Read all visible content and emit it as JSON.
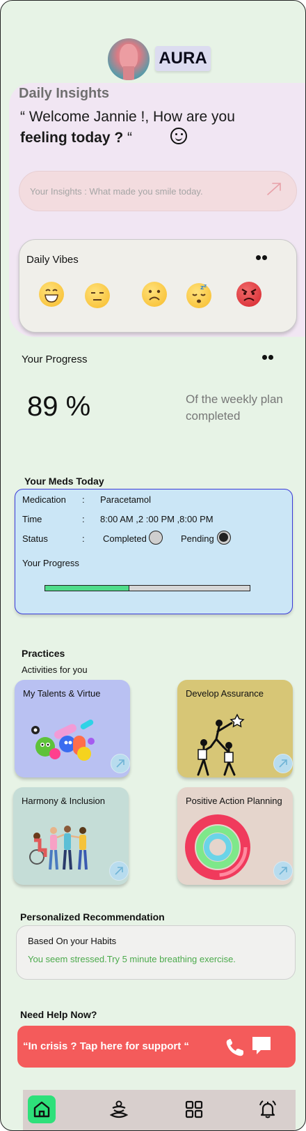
{
  "app": {
    "name": "AURA"
  },
  "insights": {
    "title": "Daily Insights",
    "welcome_prefix": "“ Welcome Jannie !, How are you ",
    "welcome_bold": "feeling today ? ",
    "welcome_suffix": "“",
    "input_placeholder": "Your Insights : What made you smile today."
  },
  "vibes": {
    "title": "Daily Vibes",
    "emojis": [
      "grinning-face",
      "expressionless-face",
      "frowning-face",
      "sleeping-face",
      "angry-face"
    ]
  },
  "progress": {
    "title": "Your Progress",
    "percent": "89 %",
    "caption": "Of the weekly plan completed"
  },
  "meds": {
    "title": "Your Meds Today",
    "medication_label": "Medication",
    "medication_value": "Paracetamol",
    "time_label": "Time",
    "time_value": "8:00 AM ,2 :00 PM ,8:00 PM",
    "status_label": "Status",
    "colon": ":",
    "completed_label": "Completed",
    "pending_label": "Pending",
    "status_selected": "Pending",
    "progress_label": "Your Progress",
    "progress_fraction": 0.41
  },
  "practices": {
    "title": "Practices",
    "subtitle": "Activities for you",
    "cards": [
      {
        "title": "My Talents & Virtue",
        "color": "#b9c1f2"
      },
      {
        "title": "Develop Assurance",
        "color": "#d7c676"
      },
      {
        "title": "Harmony & Inclusion",
        "color": "#c5ddd7"
      },
      {
        "title": "Positive Action Planning",
        "color": "#e5d5cc"
      }
    ]
  },
  "recommendation": {
    "title": "Personalized Recommendation",
    "subtitle": "Based On your Habits",
    "message": "You seem stressed.Try 5 minute breathing exercise."
  },
  "help": {
    "title": "Need Help Now?",
    "banner": "“In crisis ? Tap here for support “"
  },
  "nav": {
    "items": [
      "home-icon",
      "meditation-icon",
      "grid-icon",
      "bell-icon"
    ],
    "active": "home-icon"
  },
  "colors": {
    "background": "#e7f3e6",
    "accent": "#2ee07a",
    "crisis": "#f45b5b",
    "card_blue": "#cbe6f6"
  }
}
